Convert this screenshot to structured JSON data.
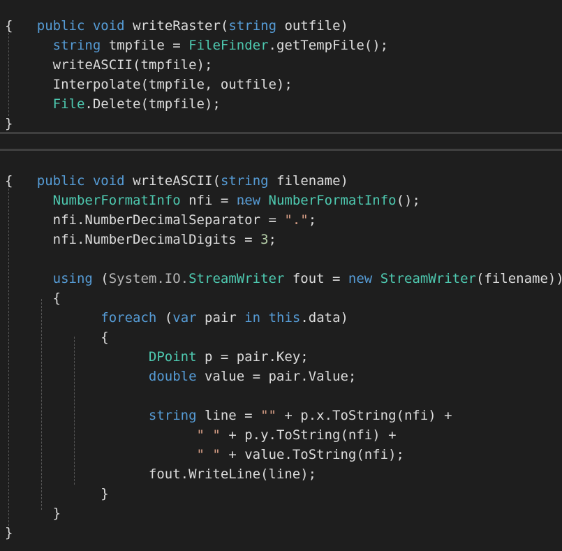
{
  "block1": {
    "sig": {
      "public": "public",
      "void": "void",
      "name_first": "w",
      "name_rest": "riteRaster",
      "open": "(",
      "ptype": "string",
      "pname": "outfile",
      "close": ")"
    },
    "open_brace": "{",
    "l1": {
      "type": "string",
      "rest1": " tmpfile = ",
      "cls": "FileFinder",
      "rest2": ".getTempFile();"
    },
    "l2": {
      "text": "writeASCII(tmpfile);"
    },
    "l3": {
      "text": "Interpolate(tmpfile, outfile);"
    },
    "l4": {
      "cls": "File",
      "rest": ".Delete(tmpfile);"
    },
    "close_brace": "}"
  },
  "block2": {
    "sig": {
      "public": "public",
      "void": "void",
      "name_first": "w",
      "name_rest": "riteASCII",
      "open": "(",
      "ptype": "string",
      "pname": "filename",
      "close": ")"
    },
    "open_brace": "{",
    "l1": {
      "type": "NumberFormatInfo",
      "mid": " nfi = ",
      "kw_new_first": "n",
      "kw_new_rest": "ew",
      "sp": " ",
      "type2": "NumberFormatInfo",
      "end": "();"
    },
    "l2": {
      "lhs": "nfi.NumberDecimalSeparator = ",
      "str": "\".\"",
      "end": ";"
    },
    "l3": {
      "lhs": "nfi.NumberDecimalDigits = ",
      "num": "3",
      "end": ";"
    },
    "l4": {
      "kw": "using",
      "p1": " (",
      "ns": "System.IO.",
      "type": "StreamWriter",
      "p2": " fout = ",
      "kw2": "new",
      "sp": " ",
      "type2": "StreamWriter",
      "end": "(filename))"
    },
    "l5": {
      "brace": "{"
    },
    "l6": {
      "kw": "foreach",
      "p1": " (",
      "kw2": "var",
      "p2": " pair ",
      "kw3": "in",
      "sp": " ",
      "kw4": "this",
      "end": ".data)"
    },
    "l7": {
      "brace": "{"
    },
    "l8": {
      "type": "DPoint",
      "rest": " p = pair.Key;"
    },
    "l9": {
      "kw": "double",
      "rest": " value = pair.Value;"
    },
    "l10": {
      "kw": "string",
      "p1": " line = ",
      "str": "\"\"",
      "rest": " + p.x.ToString(nfi) +"
    },
    "l11": {
      "str": "\" \"",
      "rest": " + p.y.ToString(nfi) +"
    },
    "l12": {
      "str": "\" \"",
      "rest": " + value.ToString(nfi);"
    },
    "l13": {
      "text": "fout.WriteLine(line);"
    },
    "l14": {
      "brace": "}"
    },
    "l15": {
      "brace": "}"
    },
    "close_brace": "}"
  },
  "colors": {
    "background": "#1e1e1e",
    "keyword": "#569cd6",
    "type": "#4ec9b0",
    "string": "#d69d85",
    "number": "#b5cea8",
    "identifier": "#dcdcdc"
  }
}
